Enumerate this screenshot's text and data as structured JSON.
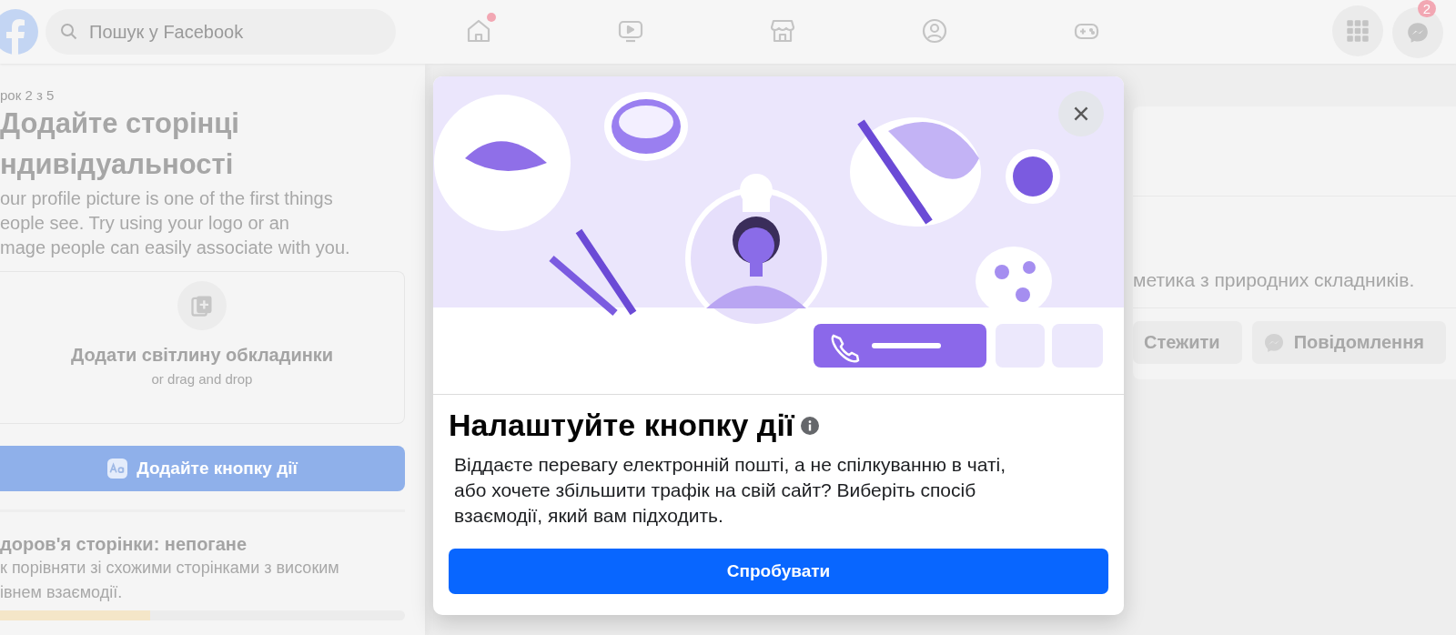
{
  "top_bar": {
    "search": {
      "placeholder": "Пошук у Facebook"
    },
    "nav": [
      {
        "kind": "home",
        "selected": false,
        "dot": true
      },
      {
        "kind": "video",
        "selected": false,
        "dot": false
      },
      {
        "kind": "store",
        "selected": false,
        "dot": false
      },
      {
        "kind": "groups",
        "selected": false,
        "dot": false
      },
      {
        "kind": "gaming",
        "selected": false,
        "dot": false
      }
    ],
    "messenger_badge": "2"
  },
  "left_panel": {
    "step": "рок 2 з 5",
    "title_lines": [
      "Додайте сторінці",
      "ндивідуальності"
    ],
    "description_lines": [
      "our profile picture is one of the first things",
      "eople see. Try using your logo or an",
      "mage people can easily associate with you."
    ],
    "cover": {
      "title": "Додати світлину обкладинки",
      "hint": "or drag and drop"
    },
    "action_button": "Додайте кнопку дії",
    "health": {
      "title": "доров'я сторінки: непогане",
      "description_lines": [
        "к порівняти зі схожими сторінками з високим",
        "івнем взаємодії."
      ],
      "level": 0.37
    }
  },
  "main": {
    "about_text": "метика з природних складників.",
    "buttons": [
      {
        "kind": "follow",
        "label": "Стежити"
      },
      {
        "kind": "message",
        "label": "Повідомлення"
      }
    ]
  },
  "modal": {
    "title": "Налаштуйте кнопку дії",
    "description": "Віддаєте перевагу електронній пошті, а не спілкуванню в чаті, або хочете збільшити трафік на свій сайт? Виберіть спосіб взаємодії, який вам підходить.",
    "button": "Спробувати"
  }
}
